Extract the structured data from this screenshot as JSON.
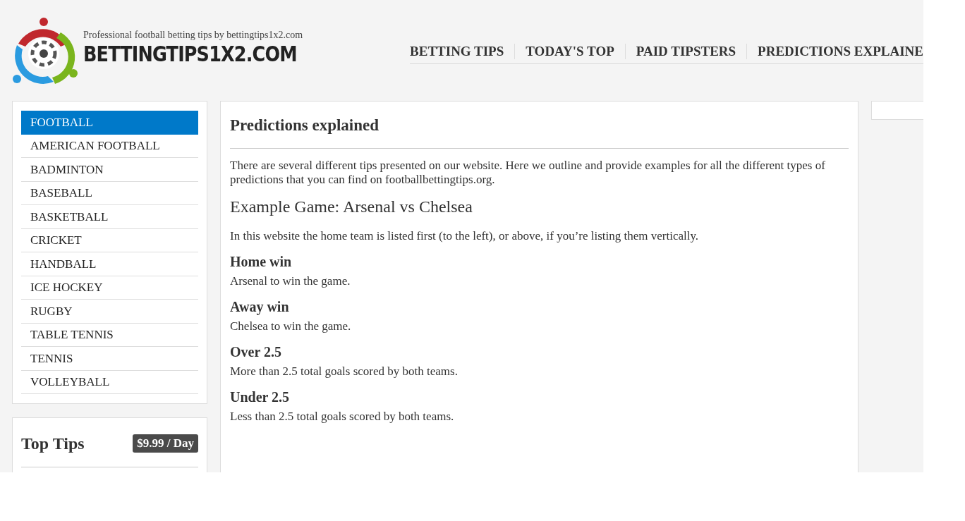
{
  "header": {
    "tagline": "Professional football betting tips by bettingtips1x2.com",
    "logo_text": "BETTINGTIPS1X2.COM"
  },
  "nav": [
    {
      "label": "BETTING TIPS"
    },
    {
      "label": "TODAY'S TOP"
    },
    {
      "label": "PAID TIPSTERS"
    },
    {
      "label": "PREDICTIONS EXPLAINE"
    }
  ],
  "sports": [
    {
      "label": "FOOTBALL",
      "selected": true
    },
    {
      "label": "AMERICAN FOOTBALL",
      "selected": false
    },
    {
      "label": "BADMINTON",
      "selected": false
    },
    {
      "label": "BASEBALL",
      "selected": false
    },
    {
      "label": "BASKETBALL",
      "selected": false
    },
    {
      "label": "CRICKET",
      "selected": false
    },
    {
      "label": "HANDBALL",
      "selected": false
    },
    {
      "label": "ICE HOCKEY",
      "selected": false
    },
    {
      "label": "RUGBY",
      "selected": false
    },
    {
      "label": "TABLE TENNIS",
      "selected": false
    },
    {
      "label": "TENNIS",
      "selected": false
    },
    {
      "label": "VOLLEYBALL",
      "selected": false
    }
  ],
  "top_tips": {
    "title": "Top Tips",
    "price": "$9.99 / Day"
  },
  "article": {
    "title": "Predictions explained",
    "blocks": [
      {
        "kind": "paragraph",
        "text": "There are several different tips presented on our website. Here we outline and provide examples for all the different types of predictions that you can find on footballbettingtips.org."
      },
      {
        "kind": "subtitle",
        "text": "Example Game: Arsenal vs Chelsea"
      },
      {
        "kind": "paragraph",
        "text": "In this website the home team is listed first (to the left), or above, if you’re listing them vertically."
      },
      {
        "kind": "heading",
        "text": "Home win"
      },
      {
        "kind": "paragraph",
        "text": "Arsenal to win the game."
      },
      {
        "kind": "heading",
        "text": "Away win"
      },
      {
        "kind": "paragraph",
        "text": "Chelsea to win the game."
      },
      {
        "kind": "heading",
        "text": "Over 2.5"
      },
      {
        "kind": "paragraph",
        "text": "More than 2.5 total goals scored by both teams."
      },
      {
        "kind": "heading",
        "text": "Under 2.5"
      },
      {
        "kind": "paragraph",
        "text": "Less than 2.5 total goals scored by both teams."
      }
    ]
  }
}
